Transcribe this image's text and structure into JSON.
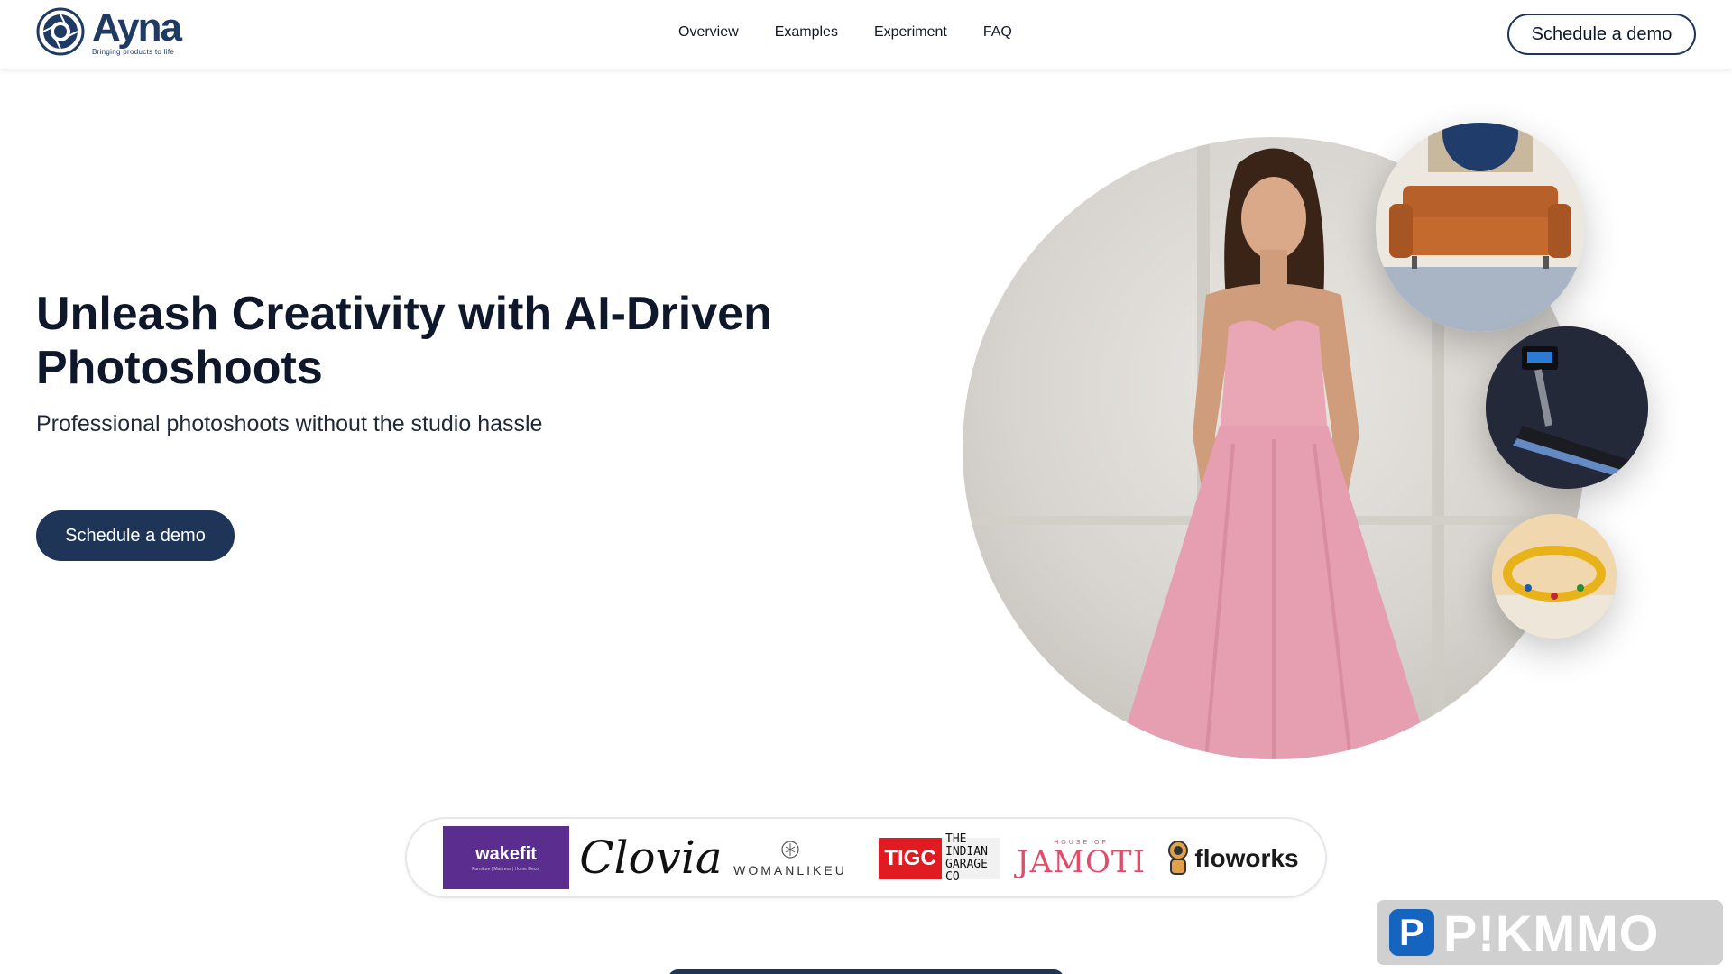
{
  "header": {
    "brand_name": "Ayna",
    "brand_tagline": "Bringing products to life",
    "nav": [
      {
        "label": "Overview"
      },
      {
        "label": "Examples"
      },
      {
        "label": "Experiment"
      },
      {
        "label": "FAQ"
      }
    ],
    "cta_label": "Schedule a demo"
  },
  "hero": {
    "title": "Unleash Creativity with AI-Driven Photoshoots",
    "subtitle": "Professional photoshoots without the studio hassle",
    "cta_label": "Schedule a demo"
  },
  "brands": {
    "wakefit": {
      "name": "wakefit",
      "sub": "Furniture | Mattress | Home Decor"
    },
    "clovia": {
      "name": "Clovia"
    },
    "womanlikeu": {
      "name": "WOMANLIKEU"
    },
    "tigc": {
      "short": "TIGC",
      "long": "THE INDIAN GARAGE CO"
    },
    "jamoti": {
      "top": "HOUSE OF",
      "name": "JAMOTI"
    },
    "floworks": {
      "name": "floworks"
    }
  },
  "watermark": {
    "letter": "P",
    "text": "P!KMMO"
  },
  "colors": {
    "brand_navy": "#1e3557",
    "text": "#0f172a",
    "tigc_red": "#e11b22",
    "wakefit_purple": "#5b2d8e",
    "jamoti_pink": "#e04c6a"
  }
}
